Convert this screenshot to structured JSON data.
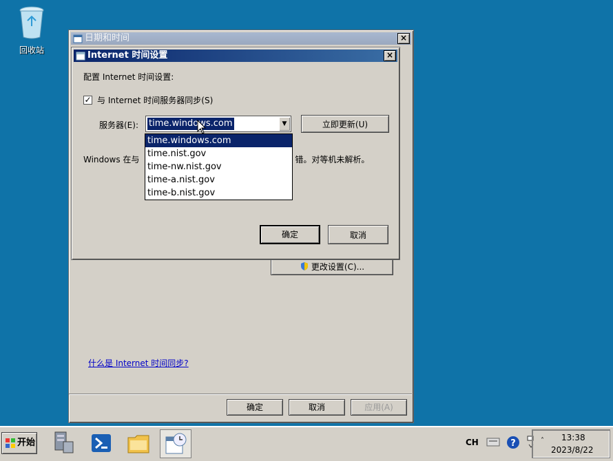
{
  "desktop": {
    "recycle_bin_label": "回收站"
  },
  "date_time_window": {
    "title": "日期和时间",
    "change_settings_label": "更改设置(C)...",
    "help_link": "什么是 Internet 时间同步?",
    "ok_label": "确定",
    "cancel_label": "取消",
    "apply_label": "应用(A)"
  },
  "internet_time_dialog": {
    "title": "Internet 时间设置",
    "config_label": "配置 Internet 时间设置:",
    "sync_checkbox_label": "与 Internet 时间服务器同步(S)",
    "sync_checked": true,
    "sync_check_glyph": "✓",
    "server_label": "服务器(E):",
    "server_value": "time.windows.com",
    "update_now_label": "立即更新(U)",
    "note_left": "Windows 在与",
    "note_right": "错。对等机未解析。",
    "ok_label": "确定",
    "cancel_label": "取消",
    "server_options": [
      "time.windows.com",
      "time.nist.gov",
      "time-nw.nist.gov",
      "time-a.nist.gov",
      "time-b.nist.gov"
    ]
  },
  "taskbar": {
    "start_label": "开始",
    "language": "CH",
    "clock_time": "13:38",
    "clock_date": "2023/8/22",
    "pinned": [
      "server-manager-icon",
      "powershell-icon",
      "file-explorer-icon",
      "date-time-icon"
    ]
  },
  "colors": {
    "desktop": "#0f73a8",
    "selection": "#0a246a",
    "window_face": "#d4d0c8"
  }
}
